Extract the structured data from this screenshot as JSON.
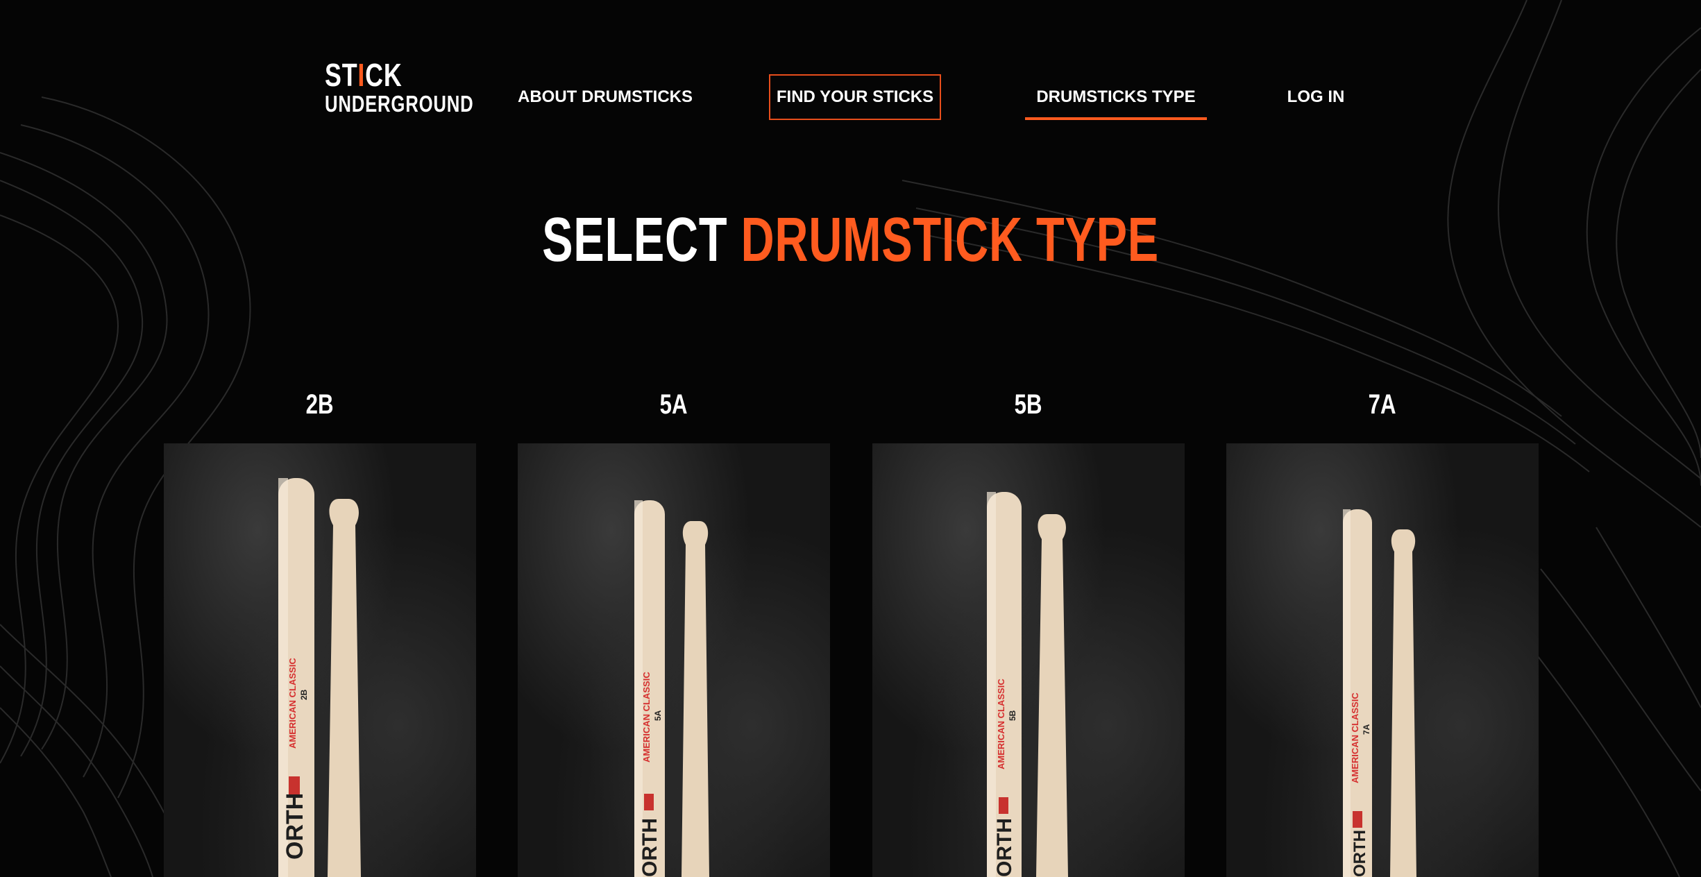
{
  "logo": {
    "line1_a": "ST",
    "line1_b": "I",
    "line1_c": "CK",
    "line2": "UNDERGROUND"
  },
  "nav": {
    "about": "ABOUT DRUMSTICKS",
    "find": "FIND YOUR STICKS",
    "type": "DRUMSTICKS TYPE",
    "login": "LOG IN"
  },
  "hero": {
    "title_a": "SELECT ",
    "title_b": "DRUMSTICK TYPE"
  },
  "cards": [
    {
      "label": "2B",
      "brand": "AMERICAN CLASSIC",
      "size": "2B"
    },
    {
      "label": "5A",
      "brand": "AMERICAN CLASSIC",
      "size": "5A"
    },
    {
      "label": "5B",
      "brand": "AMERICAN CLASSIC",
      "size": "5B"
    },
    {
      "label": "7A",
      "brand": "AMERICAN CLASSIC",
      "size": "7A"
    }
  ],
  "colors": {
    "accent": "#ff5b1f",
    "background": "#050505",
    "wood": "#e8d6bd"
  }
}
